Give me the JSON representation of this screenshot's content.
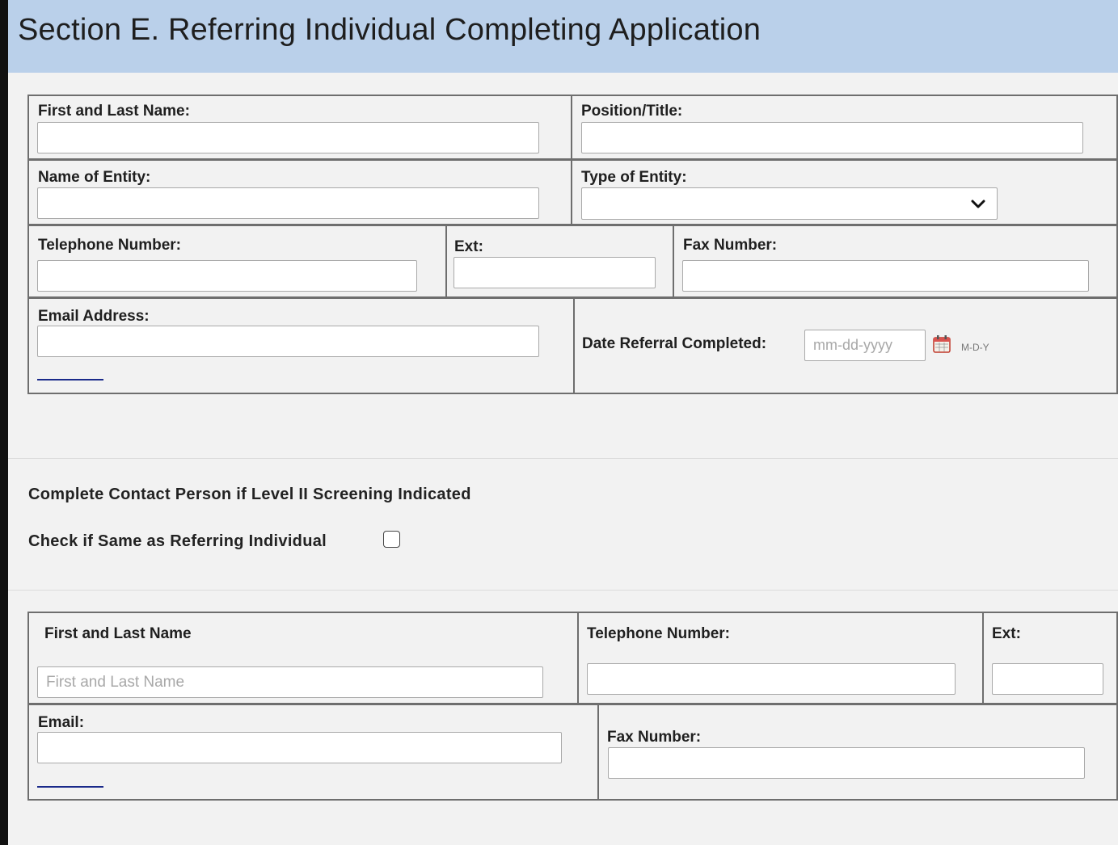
{
  "section": {
    "title": "Section E. Referring Individual Completing Application"
  },
  "referring": {
    "first_last_name_label": "First and Last Name:",
    "position_title_label": "Position/Title:",
    "entity_name_label": "Name of Entity:",
    "entity_type_label": "Type of Entity:",
    "telephone_label": "Telephone Number:",
    "ext_label": "Ext:",
    "fax_label": "Fax Number:",
    "email_label": "Email Address:",
    "date_label": "Date Referral Completed:",
    "date_placeholder": "mm-dd-yyyy",
    "date_format_hint": "M-D-Y"
  },
  "contact_intro": {
    "heading": "Complete Contact Person if Level II Screening Indicated",
    "same_as_label": "Check if Same as Referring Individual",
    "same_as_checked": false
  },
  "contact": {
    "first_last_name_label": "First and Last Name",
    "first_last_name_placeholder": "First and Last Name",
    "telephone_label": "Telephone Number:",
    "ext_label": "Ext:",
    "email_label": "Email:",
    "fax_label": "Fax Number:"
  },
  "icons": {
    "type_dropdown": "chevron-down-icon",
    "date_picker": "calendar-icon"
  }
}
